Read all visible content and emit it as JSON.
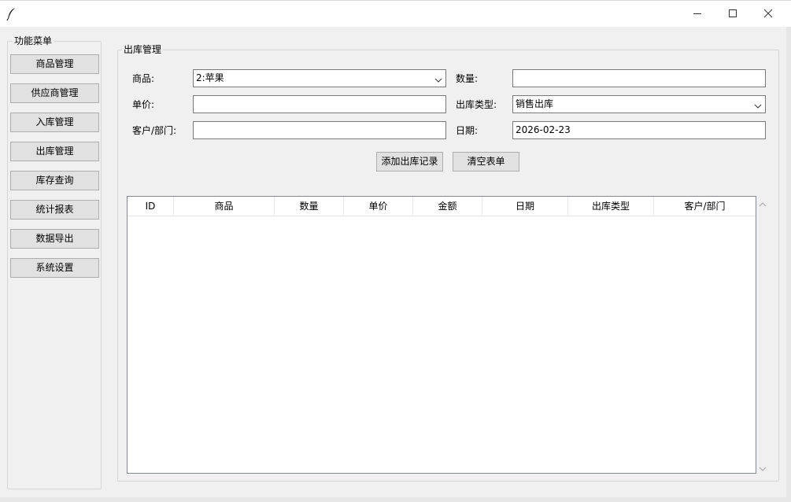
{
  "window": {
    "icon": "feather-icon",
    "controls": [
      "minimize-icon",
      "maximize-icon",
      "close-icon"
    ]
  },
  "sidebar": {
    "title": "功能菜单",
    "items": [
      {
        "label": "商品管理"
      },
      {
        "label": "供应商管理"
      },
      {
        "label": "入库管理"
      },
      {
        "label": "出库管理"
      },
      {
        "label": "库存查询"
      },
      {
        "label": "统计报表"
      },
      {
        "label": "数据导出"
      },
      {
        "label": "系统设置"
      }
    ]
  },
  "main": {
    "title": "出库管理",
    "form": {
      "product_label": "商品:",
      "product_value": "2:苹果",
      "quantity_label": "数量:",
      "quantity_value": "",
      "unit_price_label": "单价:",
      "unit_price_value": "",
      "type_label": "出库类型:",
      "type_value": "销售出库",
      "customer_label": "客户/部门:",
      "customer_value": "",
      "date_label": "日期:",
      "date_value": "2026-02-23"
    },
    "buttons": {
      "add": "添加出库记录",
      "clear": "清空表单"
    },
    "table": {
      "columns": [
        "ID",
        "商品",
        "数量",
        "单价",
        "金额",
        "日期",
        "出库类型",
        "客户/部门"
      ],
      "rows": []
    }
  },
  "colors": {
    "background": "#f0f0f0",
    "button": "#e1e1e1",
    "input_border": "#7a7a7a"
  }
}
